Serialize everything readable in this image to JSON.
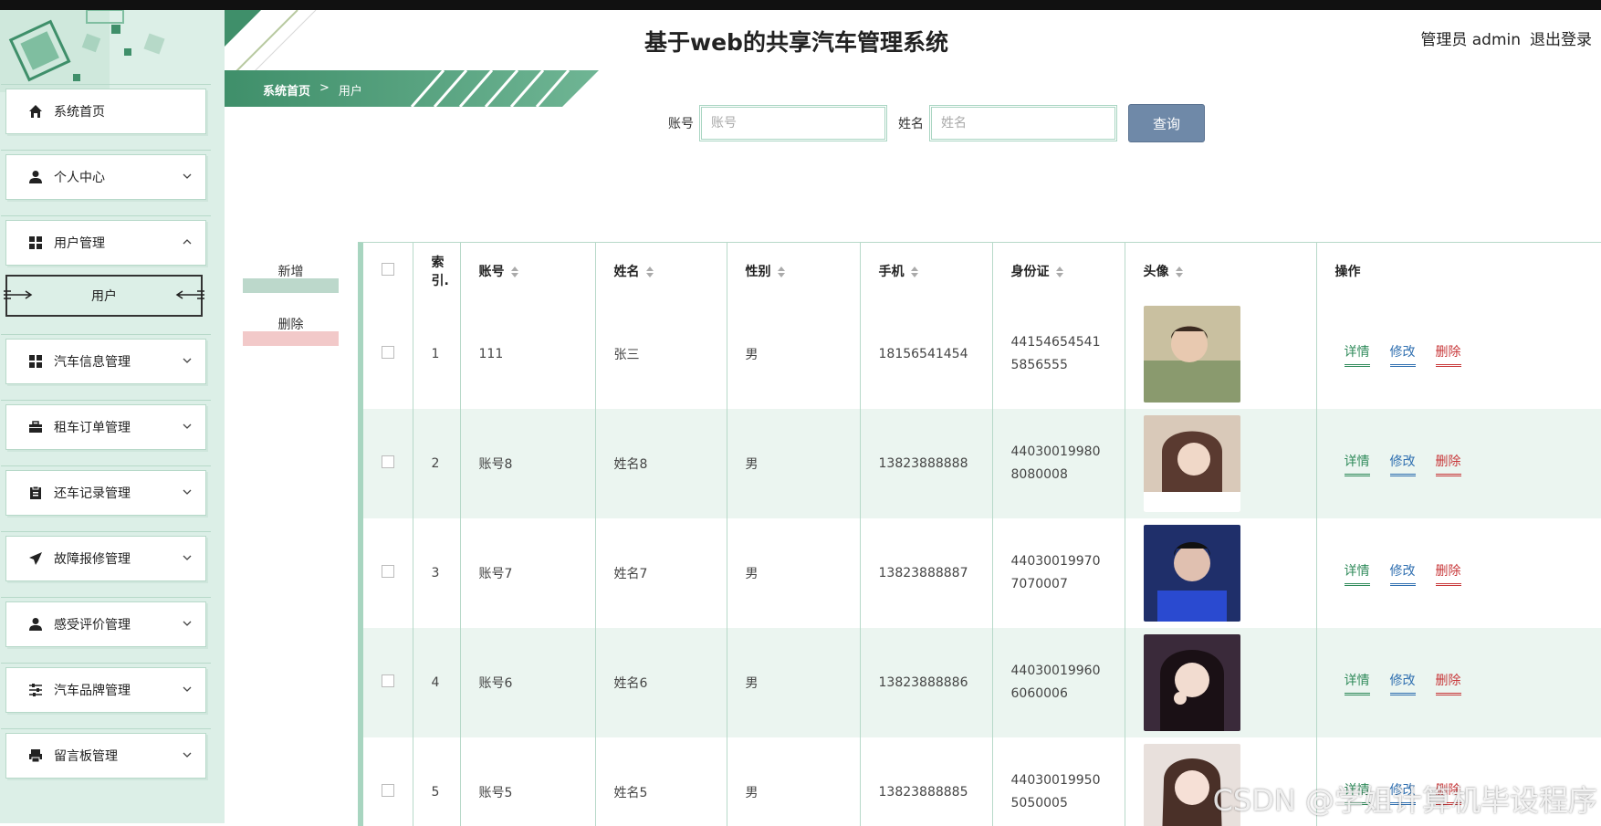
{
  "app": {
    "title": "基于web的共享汽车管理系统",
    "user_role": "管理员 admin",
    "logout": "退出登录",
    "accent": "#3f8f6a",
    "sidebar_bg": "#dcefe7"
  },
  "sidebar": {
    "items": [
      {
        "label": "系统首页",
        "icon": "home-icon",
        "expandable": false
      },
      {
        "label": "个人中心",
        "icon": "person-icon",
        "expandable": true,
        "expanded": false
      },
      {
        "label": "用户管理",
        "icon": "grid-icon",
        "expandable": true,
        "expanded": true
      },
      {
        "label": "汽车信息管理",
        "icon": "grid-icon",
        "expandable": true,
        "expanded": false
      },
      {
        "label": "租车订单管理",
        "icon": "briefcase-icon",
        "expandable": true,
        "expanded": false
      },
      {
        "label": "还车记录管理",
        "icon": "clipboard-icon",
        "expandable": true,
        "expanded": false
      },
      {
        "label": "故障报修管理",
        "icon": "paper-plane-icon",
        "expandable": true,
        "expanded": false
      },
      {
        "label": "感受评价管理",
        "icon": "person-icon",
        "expandable": true,
        "expanded": false
      },
      {
        "label": "汽车品牌管理",
        "icon": "sliders-icon",
        "expandable": true,
        "expanded": false
      },
      {
        "label": "留言板管理",
        "icon": "printer-icon",
        "expandable": true,
        "expanded": false
      }
    ],
    "sub_active": "用户"
  },
  "breadcrumb": {
    "home": "系统首页",
    "separator": ">",
    "current": "用户"
  },
  "search": {
    "account_label": "账号",
    "account_placeholder": "账号",
    "name_label": "姓名",
    "name_placeholder": "姓名",
    "query_button": "查询"
  },
  "actions": {
    "add": "新增",
    "delete": "删除"
  },
  "table": {
    "headers": {
      "index": "索引.",
      "account": "账号",
      "name": "姓名",
      "gender": "性别",
      "phone": "手机",
      "idcard": "身份证",
      "avatar": "头像",
      "ops": "操作"
    },
    "ops_labels": {
      "detail": "详情",
      "edit": "修改",
      "delete": "删除"
    },
    "rows": [
      {
        "index": "1",
        "account": "111",
        "name": "张三",
        "gender": "男",
        "phone": "18156541454",
        "idcard_1": "44154654541",
        "idcard_2": "5856555",
        "avatar_color": "#8a9a6e"
      },
      {
        "index": "2",
        "account": "账号8",
        "name": "姓名8",
        "gender": "男",
        "phone": "13823888888",
        "idcard_1": "44030019980",
        "idcard_2": "8080008",
        "avatar_color": "#5a3a30"
      },
      {
        "index": "3",
        "account": "账号7",
        "name": "姓名7",
        "gender": "男",
        "phone": "13823888887",
        "idcard_1": "44030019970",
        "idcard_2": "7070007",
        "avatar_color": "#1f2f6a"
      },
      {
        "index": "4",
        "account": "账号6",
        "name": "姓名6",
        "gender": "男",
        "phone": "13823888886",
        "idcard_1": "44030019960",
        "idcard_2": "6060006",
        "avatar_color": "#3a2a3a"
      },
      {
        "index": "5",
        "account": "账号5",
        "name": "姓名5",
        "gender": "男",
        "phone": "13823888885",
        "idcard_1": "44030019950",
        "idcard_2": "5050005",
        "avatar_color": "#c9a99a"
      }
    ]
  },
  "watermark": "CSDN @学姐计算机毕设程序"
}
